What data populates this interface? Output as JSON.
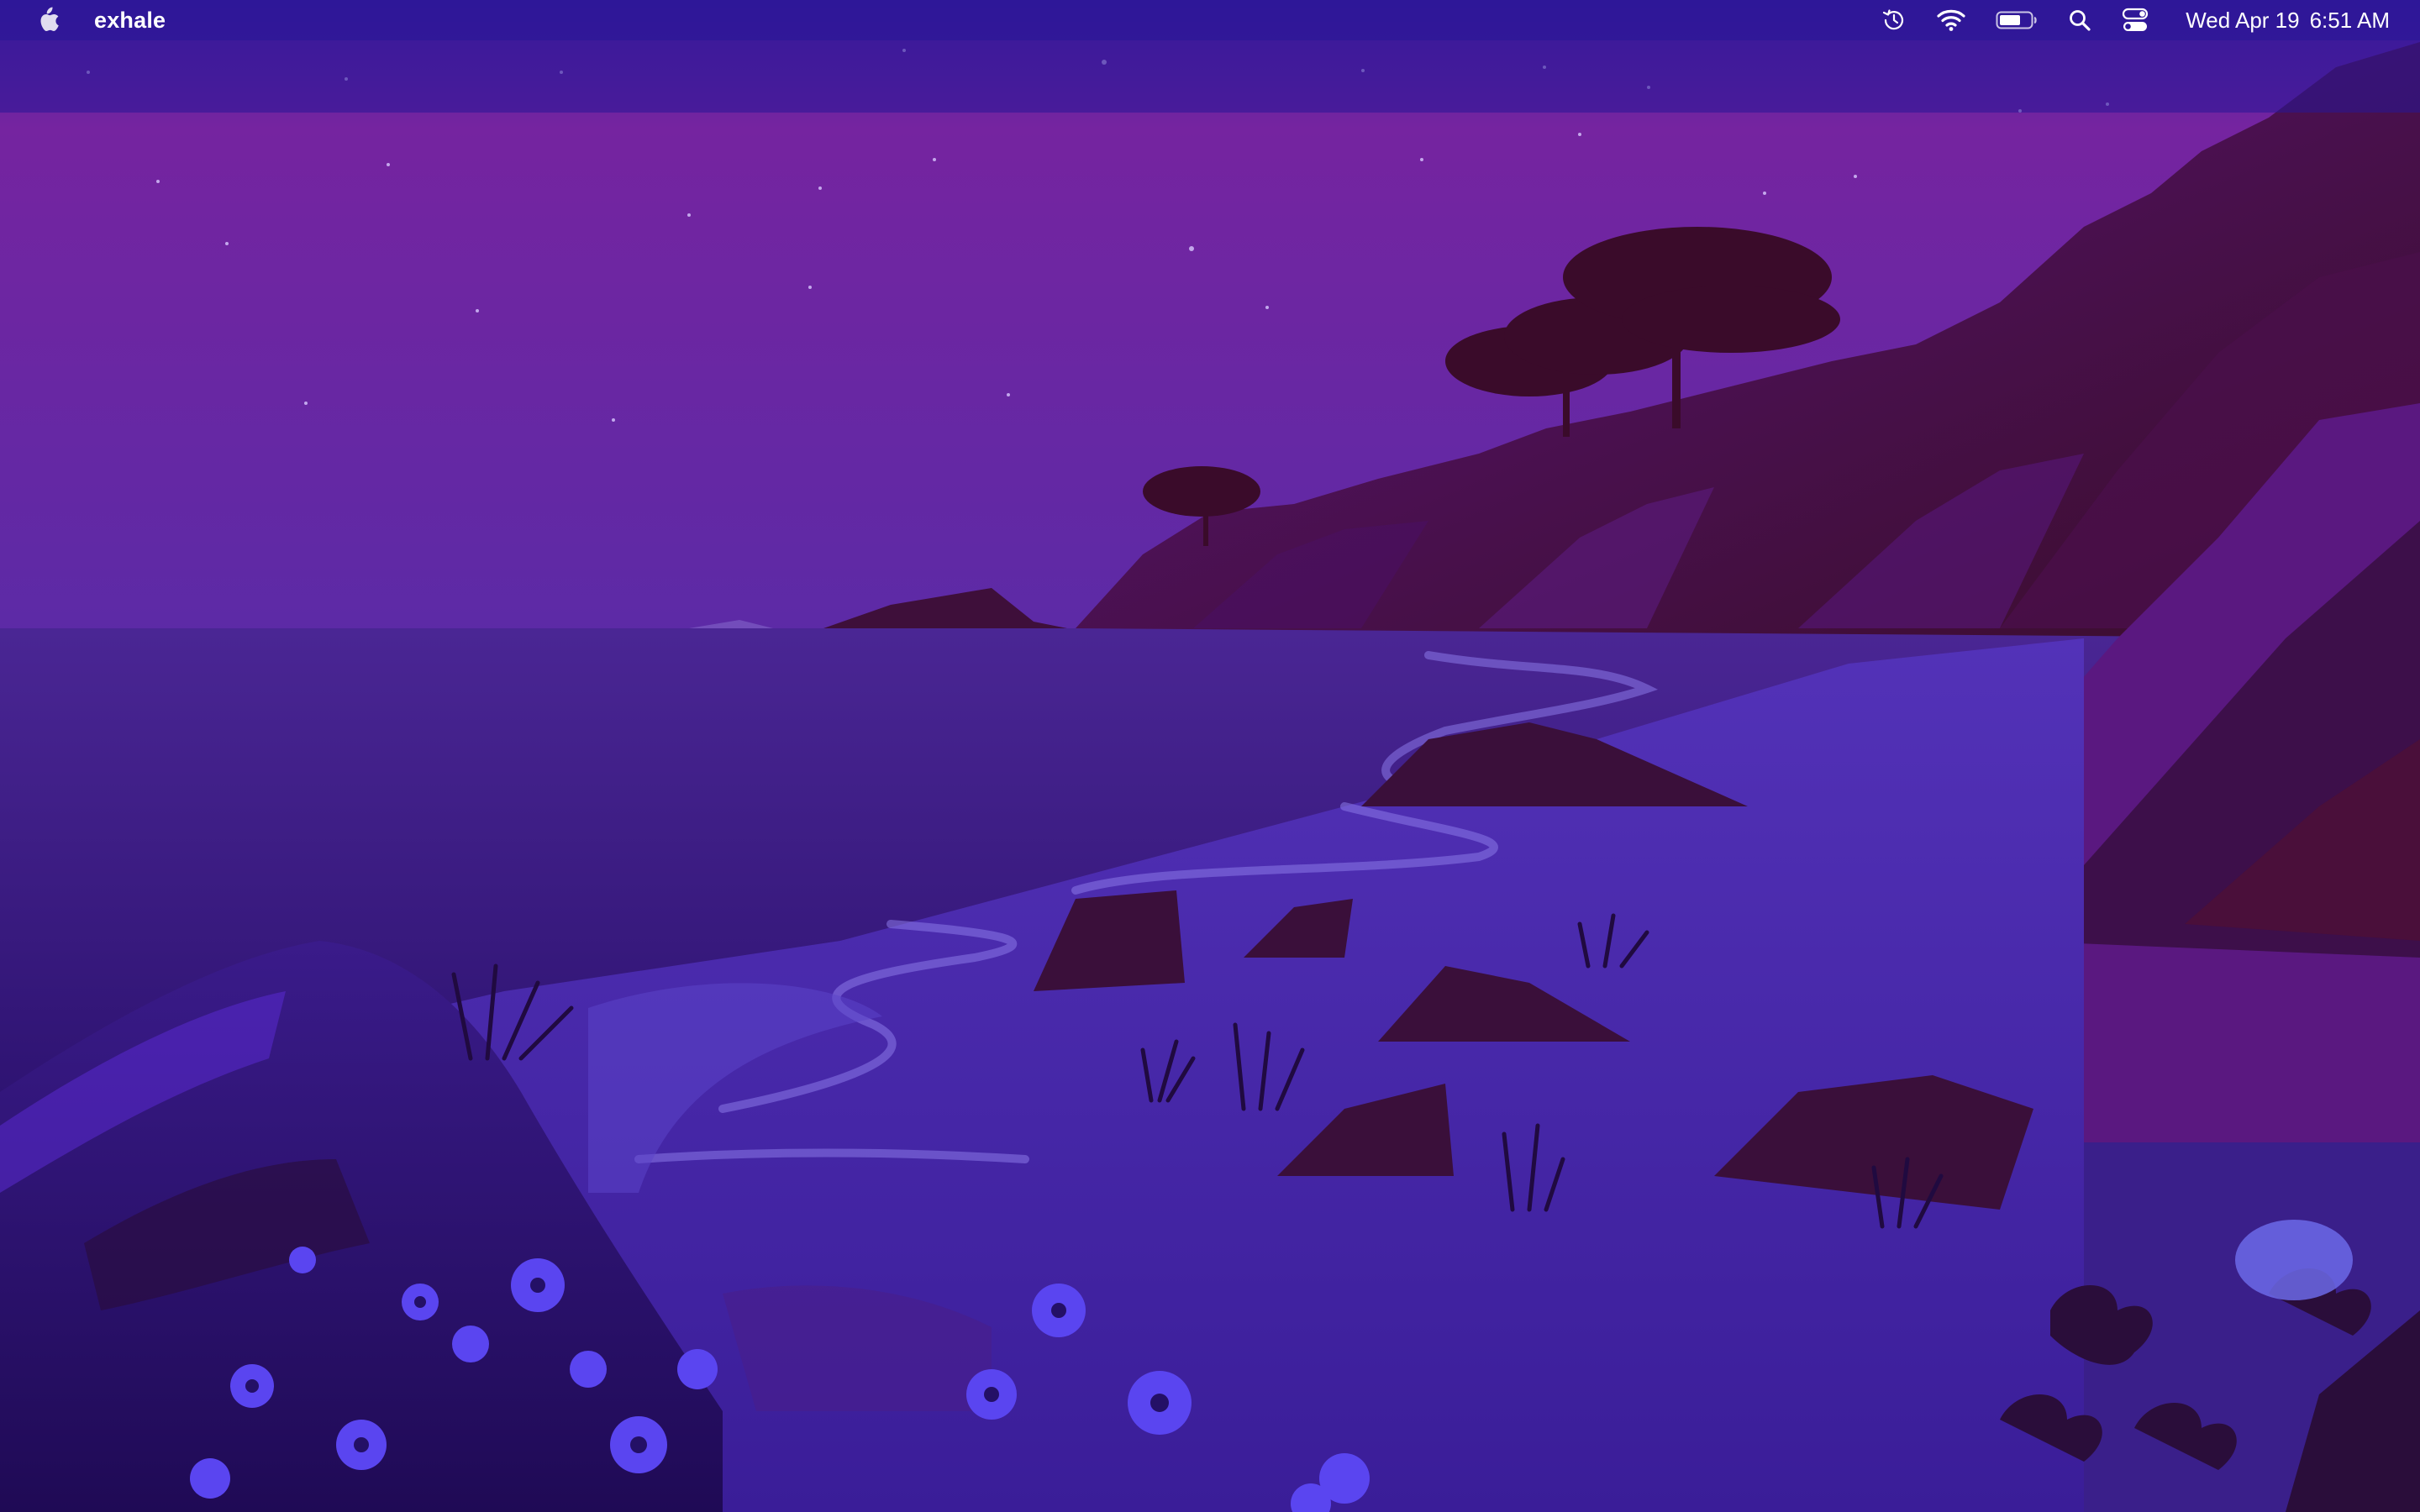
{
  "menubar": {
    "apple_menu": "apple-logo-icon",
    "app_name": "exhale",
    "status_icons": [
      "time-machine-icon",
      "wifi-icon",
      "battery-icon",
      "spotlight-search-icon",
      "control-center-icon"
    ],
    "date": "Wed Apr 19",
    "time": "6:51 AM"
  },
  "wallpaper": {
    "name": "macOS Big Sur Coastline (night)",
    "colors": {
      "sky_top": "#5b2296",
      "sky_bottom": "#5a2ea8",
      "cliff_dark": "#3d0f35",
      "water": "#3e1f86",
      "sand": "#4827a8",
      "foreground": "#2a0f66",
      "flowers": "#5a45f0"
    }
  }
}
